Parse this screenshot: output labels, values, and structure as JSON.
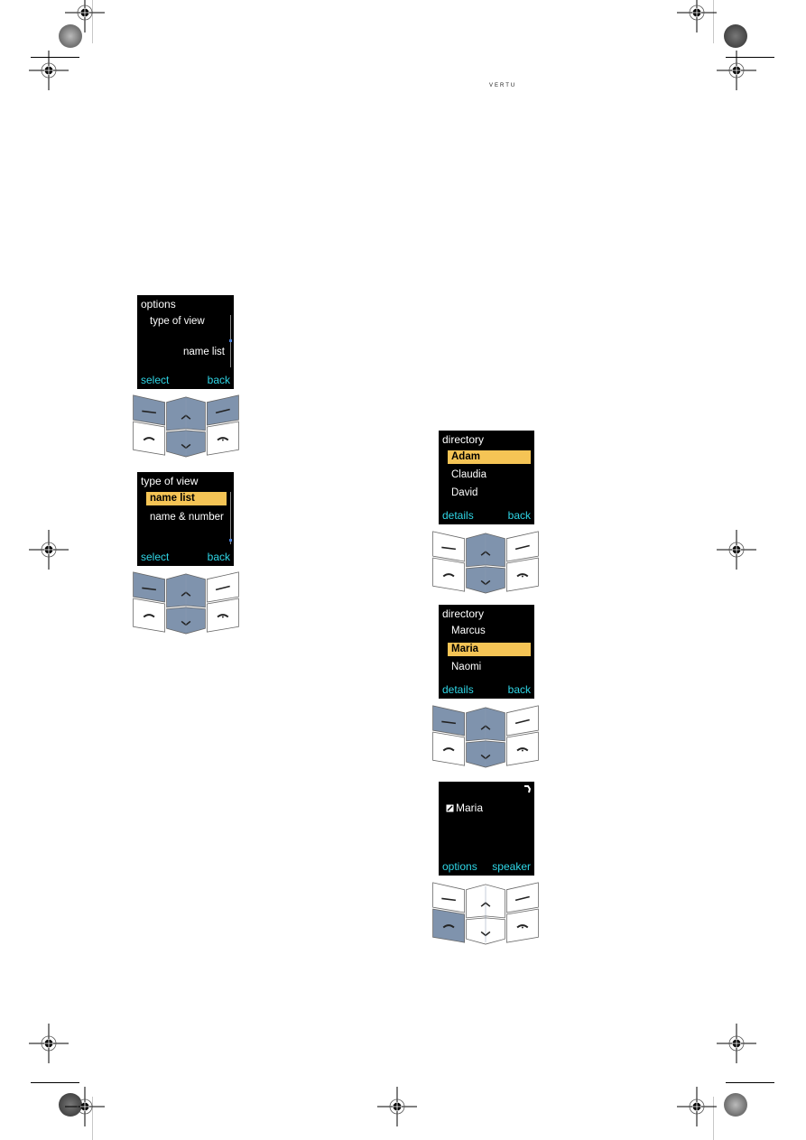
{
  "header": {
    "brand": "VERTU"
  },
  "colors": {
    "highlight": "#f5c455",
    "softkey_text": "#2fd6e6",
    "key_active": "#7f93ad",
    "key_idle": "#ffffff",
    "screen_bg": "#000000"
  },
  "screens": [
    {
      "id": "options",
      "title": "options",
      "rows": [
        {
          "label": "type of view",
          "align": "left",
          "selected": false
        },
        {
          "label": "name list",
          "align": "right",
          "selected": false
        }
      ],
      "soft_left": "select",
      "soft_right": "back",
      "active_keys": [
        "left-soft",
        "right-soft",
        "up",
        "down"
      ]
    },
    {
      "id": "type-of-view",
      "title": "type of view",
      "rows": [
        {
          "label": "name list",
          "selected": true
        },
        {
          "label": "name & number",
          "selected": false
        }
      ],
      "soft_left": "select",
      "soft_right": "back",
      "active_keys": [
        "left-soft",
        "up",
        "down"
      ]
    },
    {
      "id": "directory-1",
      "title": "directory",
      "rows": [
        {
          "label": "Adam",
          "selected": true
        },
        {
          "label": "Claudia",
          "selected": false
        },
        {
          "label": "David",
          "selected": false
        }
      ],
      "soft_left": "details",
      "soft_right": "back",
      "active_keys": [
        "up",
        "down"
      ]
    },
    {
      "id": "directory-2",
      "title": "directory",
      "rows": [
        {
          "label": "Marcus",
          "selected": false
        },
        {
          "label": "Maria",
          "selected": true
        },
        {
          "label": "Naomi",
          "selected": false
        }
      ],
      "soft_left": "details",
      "soft_right": "back",
      "active_keys": [
        "left-soft",
        "up",
        "down"
      ]
    },
    {
      "id": "calling",
      "title": "",
      "contact": "Maria",
      "soft_left": "options",
      "soft_right": "speaker",
      "active_keys": [
        "call"
      ]
    }
  ]
}
